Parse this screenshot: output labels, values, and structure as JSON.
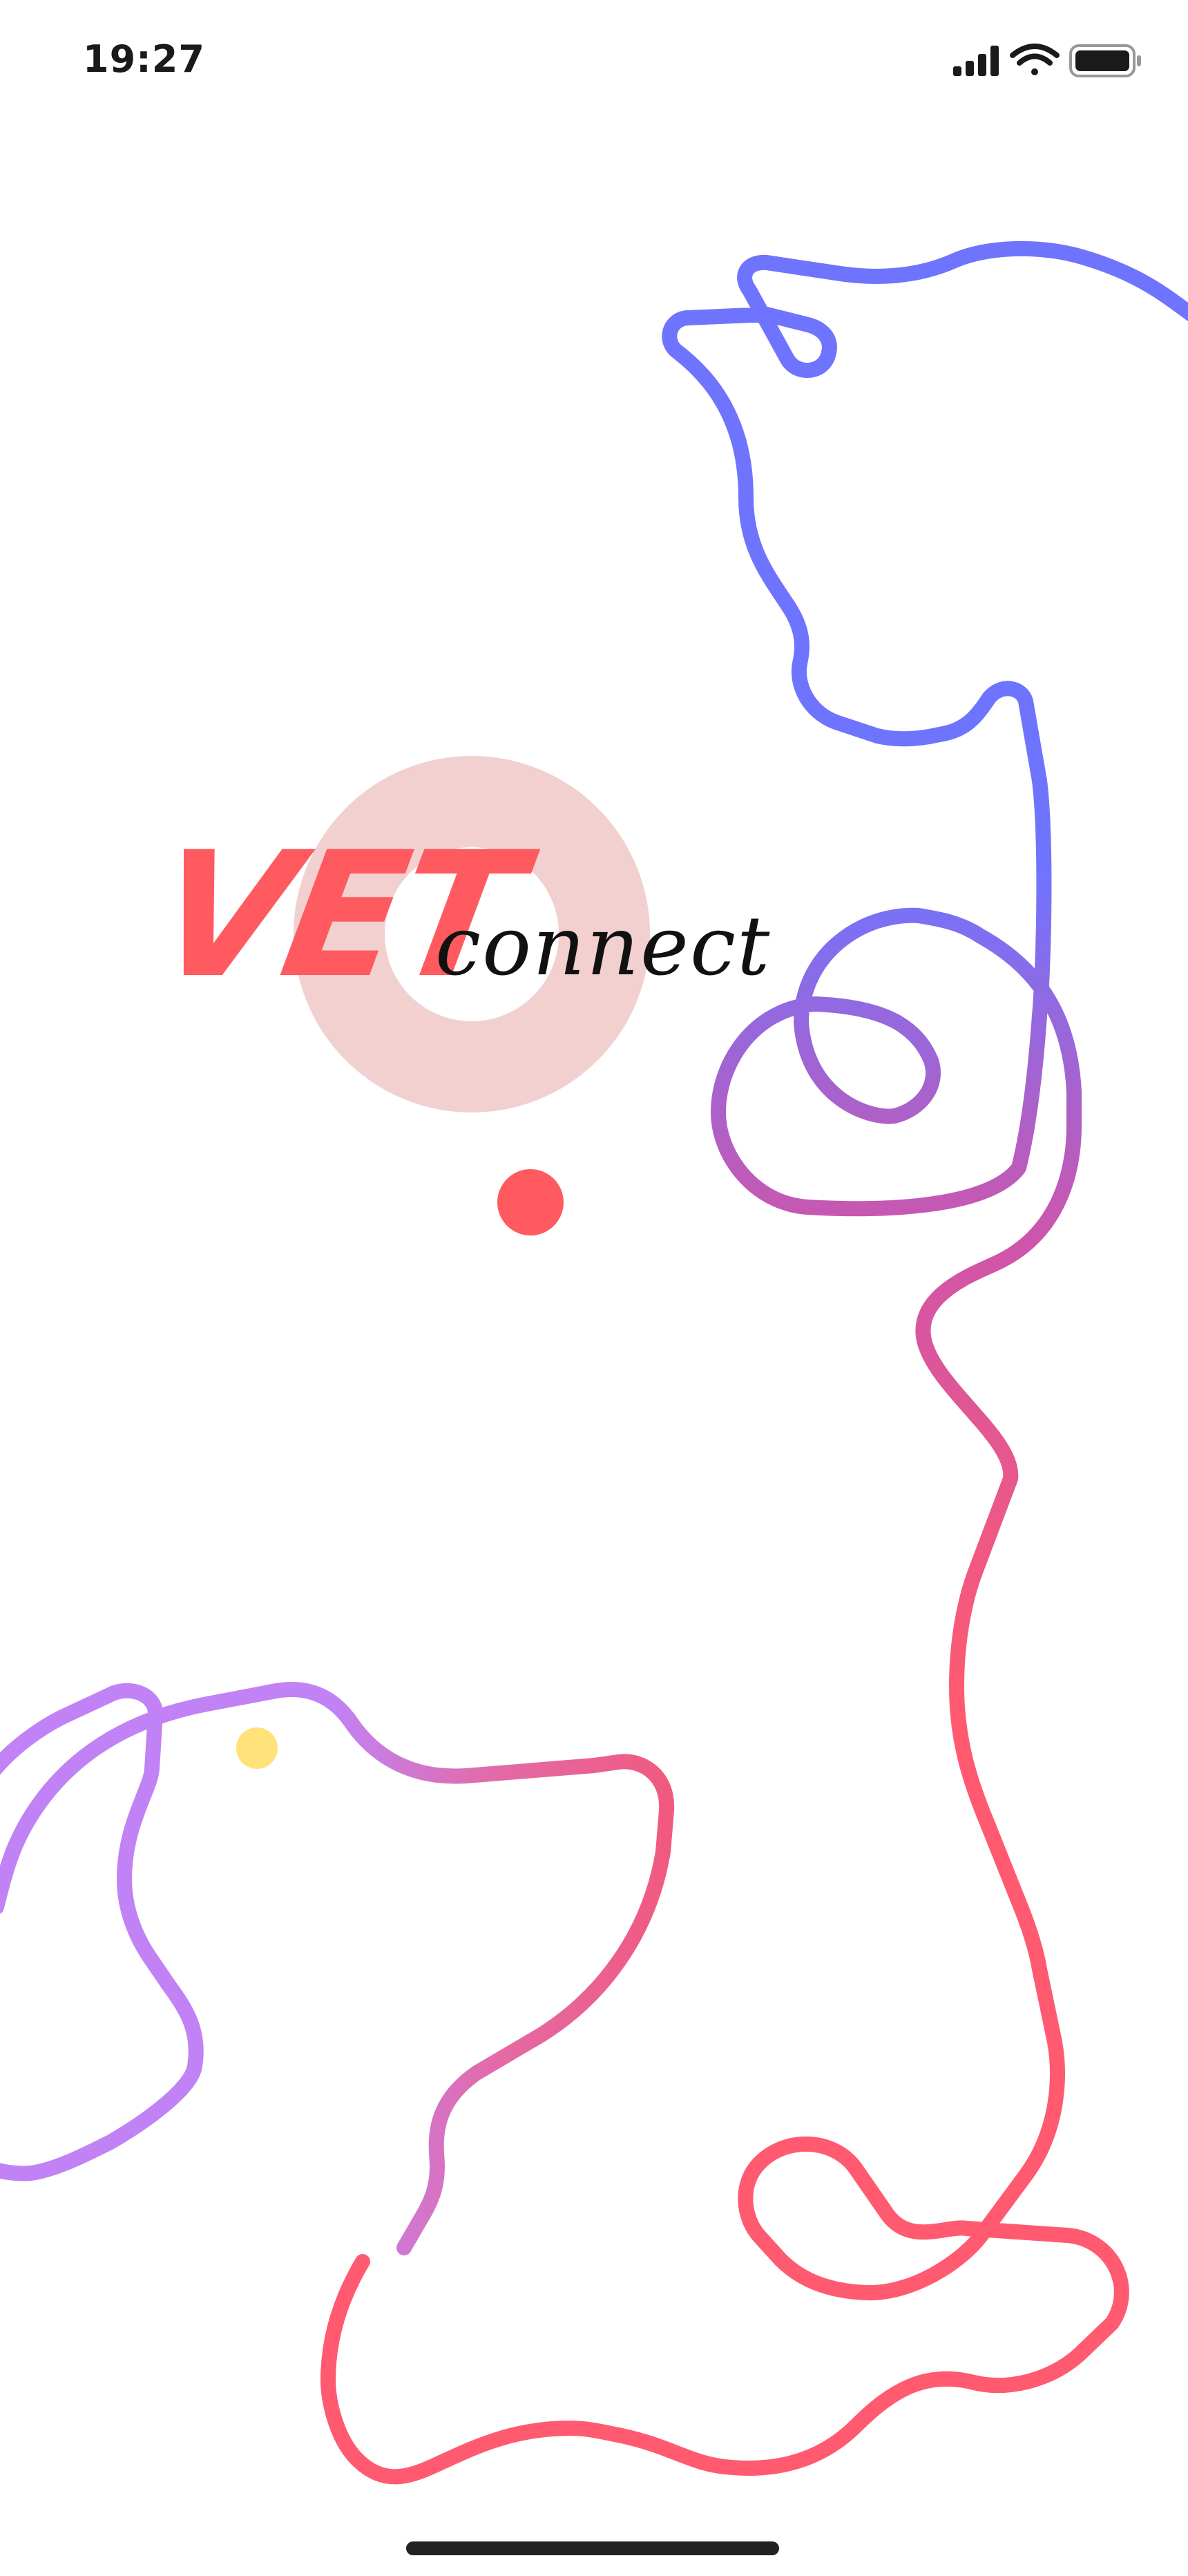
{
  "status_bar": {
    "time": "19:27",
    "icons": [
      "cellular-signal-icon",
      "wifi-icon",
      "battery-icon"
    ]
  },
  "logo": {
    "primary": "VET",
    "secondary": "connect"
  },
  "colors": {
    "brand_red": "#ff5a5f",
    "halo_pink": "#f2d0d0",
    "line_blue": "#6f74ff",
    "line_purple": "#c182f5",
    "line_pink": "#ef5d8e",
    "dot_yellow": "#ffe27a",
    "home_indicator": "#222222"
  }
}
